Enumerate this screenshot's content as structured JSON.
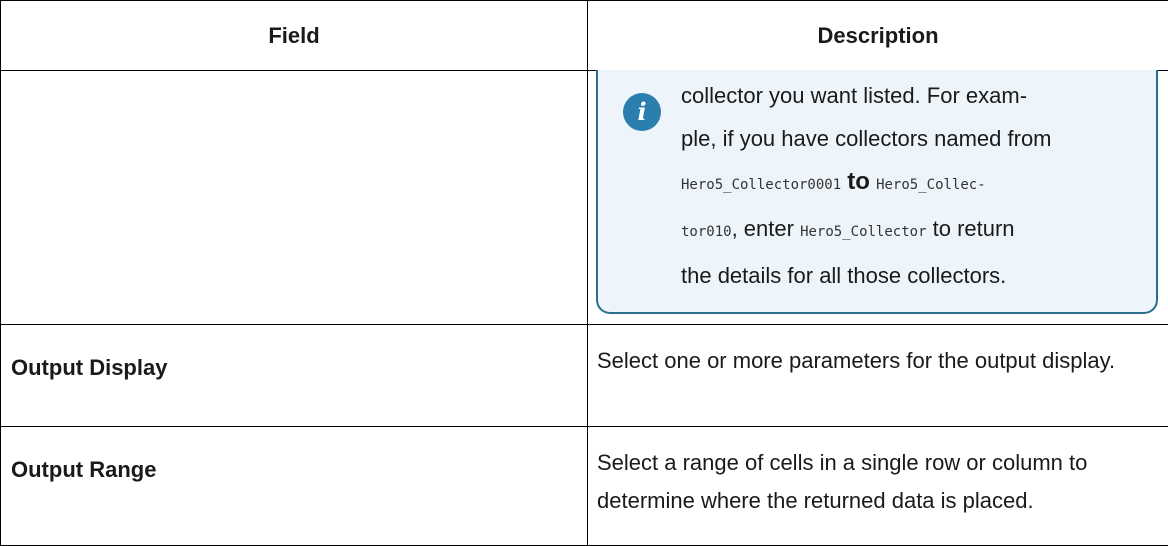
{
  "table": {
    "headers": {
      "field": "Field",
      "description": "Description"
    },
    "note": {
      "icon": "info-icon",
      "accent_color": "#2a6f8c",
      "background_color": "#eef5fa",
      "line1": "collector you want listed. For exam-",
      "line2": "ple, if you have collectors named from",
      "code1": "Hero5_Collector0001",
      "word_to": "to",
      "code2a": "Hero5_Collec-",
      "code2b": "tor010",
      "text_enter": ", enter ",
      "code3": "Hero5_Collector",
      "text_return": " to return",
      "line5": "the details for all those collectors."
    },
    "rows": [
      {
        "field": "Output Display",
        "description": "Select one or more parameters for the output display."
      },
      {
        "field": "Output Range",
        "description": "Select a range of cells in a single row or column to determine where the returned data is placed."
      }
    ]
  }
}
